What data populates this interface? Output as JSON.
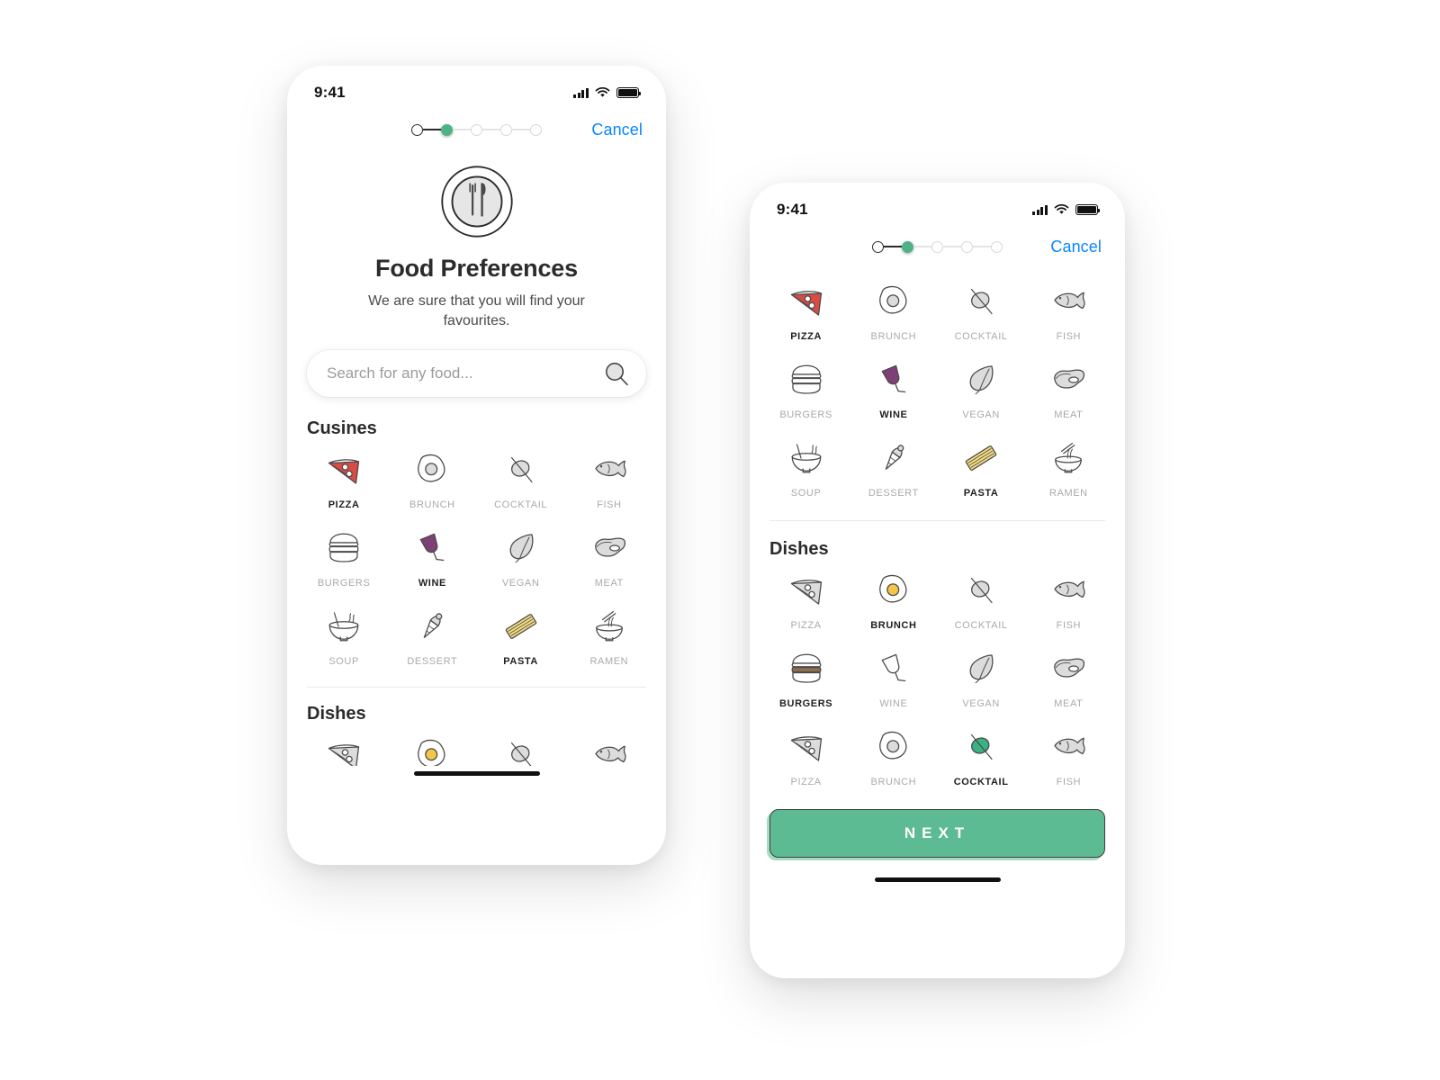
{
  "colors": {
    "green": "#5dbb93",
    "blue_link": "#0a84ff",
    "pizza_red": "#d94b43",
    "wine_purple": "#7e4077",
    "pasta_yellow": "#f5dc82",
    "egg_yolk": "#f5c54a",
    "burger_brown": "#8b6f4e",
    "cocktail_green": "#3cb183",
    "icon_gray": "#dcdcdc",
    "label_gray": "#aaaaaa",
    "text_dark": "#2b2b2b"
  },
  "status_bar": {
    "time": "9:41",
    "cellular_icon": "signal-bars-icon",
    "wifi_icon": "wifi-icon",
    "battery_icon": "battery-full-icon"
  },
  "progress": {
    "total_steps": 5,
    "current_step": 2,
    "steps": [
      {
        "state": "done"
      },
      {
        "state": "current"
      },
      {
        "state": "upcoming"
      },
      {
        "state": "upcoming"
      },
      {
        "state": "upcoming"
      }
    ]
  },
  "nav": {
    "cancel_label": "Cancel"
  },
  "hero": {
    "logo_icon": "plate-fork-knife-icon",
    "title": "Food Preferences",
    "subtitle": "We are sure that you will find your favourites."
  },
  "search": {
    "placeholder": "Search for any food...",
    "value": "",
    "icon": "search-icon"
  },
  "screen_left": {
    "cuisines": {
      "heading": "Cusines",
      "items": [
        {
          "label": "PIZZA",
          "icon": "pizza-icon",
          "selected": true
        },
        {
          "label": "BRUNCH",
          "icon": "egg-icon",
          "selected": false
        },
        {
          "label": "COCKTAIL",
          "icon": "olive-icon",
          "selected": false
        },
        {
          "label": "FISH",
          "icon": "fish-icon",
          "selected": false
        },
        {
          "label": "BURGERS",
          "icon": "burger-icon",
          "selected": false
        },
        {
          "label": "WINE",
          "icon": "wineglass-icon",
          "selected": true
        },
        {
          "label": "VEGAN",
          "icon": "leaf-icon",
          "selected": false
        },
        {
          "label": "MEAT",
          "icon": "steak-icon",
          "selected": false
        },
        {
          "label": "SOUP",
          "icon": "soup-icon",
          "selected": false
        },
        {
          "label": "DESSERT",
          "icon": "icecream-icon",
          "selected": false
        },
        {
          "label": "PASTA",
          "icon": "pasta-icon",
          "selected": true
        },
        {
          "label": "RAMEN",
          "icon": "ramen-icon",
          "selected": false
        }
      ]
    },
    "dishes": {
      "heading": "Dishes",
      "items": [
        {
          "label": "PIZZA",
          "icon": "pizza-icon",
          "selected": false
        },
        {
          "label": "BRUNCH",
          "icon": "egg-icon",
          "selected": true
        },
        {
          "label": "COCKTAIL",
          "icon": "olive-icon",
          "selected": false
        },
        {
          "label": "FISH",
          "icon": "fish-icon",
          "selected": false
        }
      ]
    }
  },
  "screen_right": {
    "cuisines": {
      "items": [
        {
          "label": "PIZZA",
          "icon": "pizza-icon",
          "selected": true
        },
        {
          "label": "BRUNCH",
          "icon": "egg-icon",
          "selected": false
        },
        {
          "label": "COCKTAIL",
          "icon": "olive-icon",
          "selected": false
        },
        {
          "label": "FISH",
          "icon": "fish-icon",
          "selected": false
        },
        {
          "label": "BURGERS",
          "icon": "burger-icon",
          "selected": false
        },
        {
          "label": "WINE",
          "icon": "wineglass-icon",
          "selected": true
        },
        {
          "label": "VEGAN",
          "icon": "leaf-icon",
          "selected": false
        },
        {
          "label": "MEAT",
          "icon": "steak-icon",
          "selected": false
        },
        {
          "label": "SOUP",
          "icon": "soup-icon",
          "selected": false
        },
        {
          "label": "DESSERT",
          "icon": "icecream-icon",
          "selected": false
        },
        {
          "label": "PASTA",
          "icon": "pasta-icon",
          "selected": true
        },
        {
          "label": "RAMEN",
          "icon": "ramen-icon",
          "selected": false
        }
      ]
    },
    "dishes": {
      "heading": "Dishes",
      "items": [
        {
          "label": "PIZZA",
          "icon": "pizza-icon",
          "selected": false
        },
        {
          "label": "BRUNCH",
          "icon": "egg-icon",
          "selected": true
        },
        {
          "label": "COCKTAIL",
          "icon": "olive-icon",
          "selected": false
        },
        {
          "label": "FISH",
          "icon": "fish-icon",
          "selected": false
        },
        {
          "label": "BURGERS",
          "icon": "burger-icon",
          "selected": true
        },
        {
          "label": "WINE",
          "icon": "wineglass-icon",
          "selected": false
        },
        {
          "label": "VEGAN",
          "icon": "leaf-icon",
          "selected": false
        },
        {
          "label": "MEAT",
          "icon": "steak-icon",
          "selected": false
        },
        {
          "label": "PIZZA",
          "icon": "pizza-icon",
          "selected": false
        },
        {
          "label": "BRUNCH",
          "icon": "egg-icon",
          "selected": false
        },
        {
          "label": "COCKTAIL",
          "icon": "olive-icon",
          "selected": true
        },
        {
          "label": "FISH",
          "icon": "fish-icon",
          "selected": false
        }
      ]
    },
    "next_button": {
      "label": "NEXT"
    }
  }
}
